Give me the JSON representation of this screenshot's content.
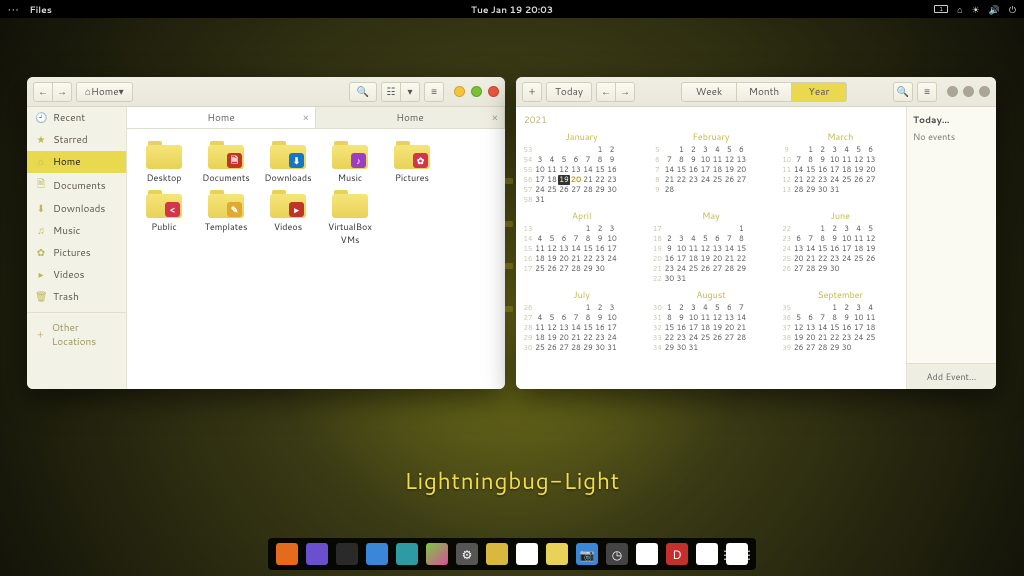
{
  "panel": {
    "menu_dots": "•••",
    "active_app": "Files",
    "clock": "Tue Jan 19  20:03",
    "battery": "1"
  },
  "files": {
    "location_label": "Home",
    "tabs": [
      {
        "label": "Home",
        "active": true
      },
      {
        "label": "Home",
        "active": false
      }
    ],
    "places": [
      {
        "icon": "🕘",
        "label": "Recent"
      },
      {
        "icon": "★",
        "label": "Starred"
      },
      {
        "icon": "⌂",
        "label": "Home",
        "active": true
      },
      {
        "icon": "🗎",
        "label": "Documents"
      },
      {
        "icon": "⬇",
        "label": "Downloads"
      },
      {
        "icon": "♫",
        "label": "Music"
      },
      {
        "icon": "✿",
        "label": "Pictures"
      },
      {
        "icon": "▸",
        "label": "Videos"
      },
      {
        "icon": "🗑",
        "label": "Trash"
      }
    ],
    "other_locations": "Other Locations",
    "items": [
      {
        "name": "Desktop"
      },
      {
        "name": "Documents",
        "badge": "b-doc",
        "glyph": "🗎"
      },
      {
        "name": "Downloads",
        "badge": "b-dl",
        "glyph": "⬇"
      },
      {
        "name": "Music",
        "badge": "b-mus",
        "glyph": "♪"
      },
      {
        "name": "Pictures",
        "badge": "b-pic",
        "glyph": "✿"
      },
      {
        "name": "Public",
        "badge": "b-pub",
        "glyph": "<"
      },
      {
        "name": "Templates",
        "badge": "b-tpl",
        "glyph": "✎"
      },
      {
        "name": "Videos",
        "badge": "b-vid",
        "glyph": "▸"
      },
      {
        "name": "VirtualBox VMs"
      }
    ]
  },
  "calendar": {
    "today_btn": "Today",
    "views": {
      "week": "Week",
      "month": "Month",
      "year": "Year",
      "selected": "year"
    },
    "year": "2021",
    "agenda": {
      "title": "Today…",
      "empty": "No events",
      "add": "Add Event…"
    },
    "today": {
      "month": 1,
      "day": 19
    },
    "months": [
      {
        "name": "January",
        "first_dow": 5,
        "ndays": 31,
        "first_week": 53
      },
      {
        "name": "February",
        "first_dow": 1,
        "ndays": 28,
        "first_week": 5
      },
      {
        "name": "March",
        "first_dow": 1,
        "ndays": 31,
        "first_week": 9
      },
      {
        "name": "April",
        "first_dow": 4,
        "ndays": 30,
        "first_week": 13
      },
      {
        "name": "May",
        "first_dow": 6,
        "ndays": 31,
        "first_week": 17
      },
      {
        "name": "June",
        "first_dow": 2,
        "ndays": 30,
        "first_week": 22
      },
      {
        "name": "July",
        "first_dow": 4,
        "ndays": 31,
        "first_week": 26
      },
      {
        "name": "August",
        "first_dow": 0,
        "ndays": 31,
        "first_week": 30
      },
      {
        "name": "September",
        "first_dow": 3,
        "ndays": 30,
        "first_week": 35
      }
    ]
  },
  "theme_name": "Lightningbug-Light",
  "dock": [
    "d-orange",
    "d-purple",
    "d-dark",
    "d-blue",
    "d-teal",
    "d-green",
    "d-gear",
    "d-yellow",
    "d-cal",
    "d-files",
    "d-cam",
    "d-clock",
    "d-help",
    "d-red",
    "d-todo",
    "d-apps"
  ]
}
